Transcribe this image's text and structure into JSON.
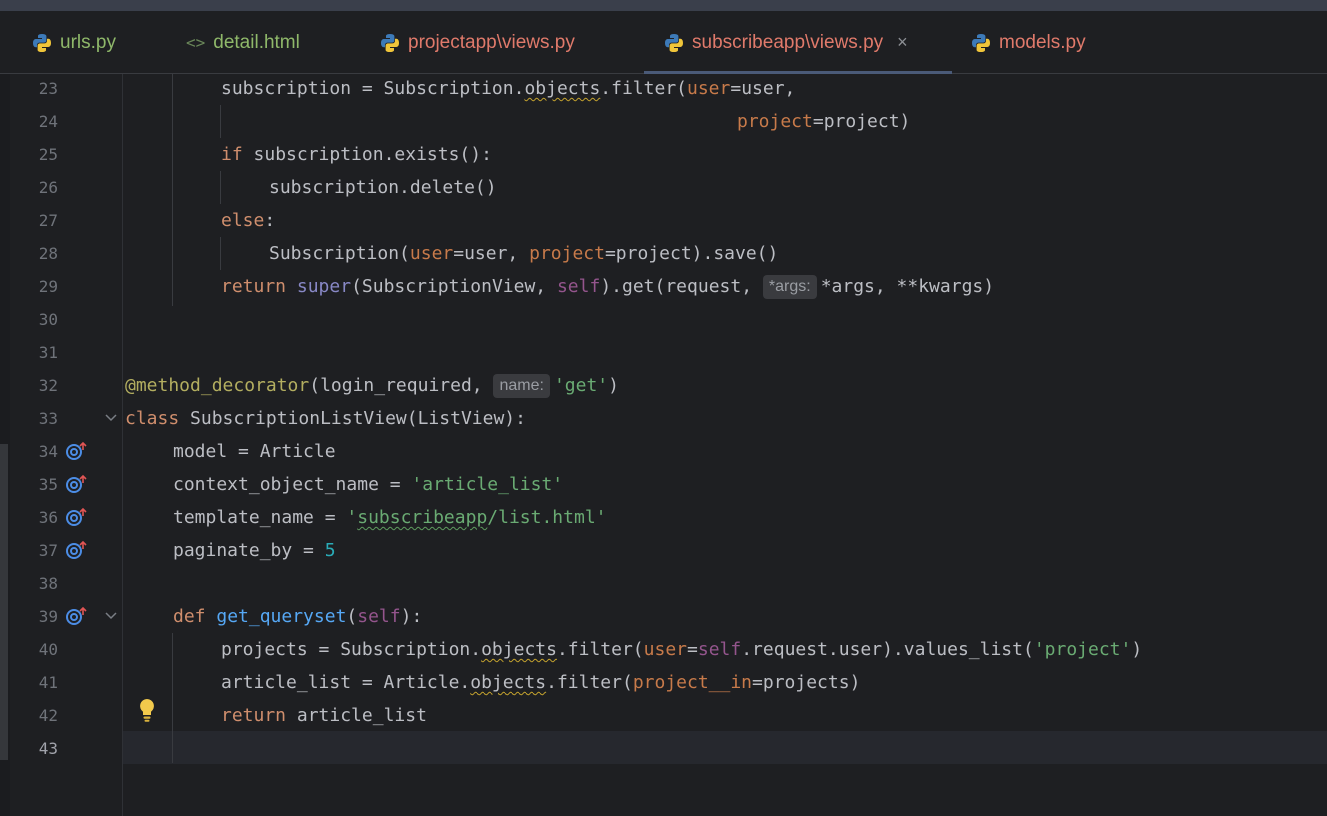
{
  "tabs": [
    {
      "label": "urls.py",
      "type": "python",
      "color": "#8fb86a"
    },
    {
      "label": "detail.html",
      "type": "html",
      "color": "#8fb86a"
    },
    {
      "label": "projectapp\\views.py",
      "type": "python",
      "color": "#e07a6b"
    },
    {
      "label": "subscribeapp\\views.py",
      "type": "python",
      "color": "#e07a6b",
      "active": true,
      "close": "×"
    },
    {
      "label": "models.py",
      "type": "python",
      "color": "#e07a6b"
    }
  ],
  "line_numbers": [
    "23",
    "24",
    "25",
    "26",
    "27",
    "28",
    "29",
    "30",
    "31",
    "32",
    "33",
    "34",
    "35",
    "36",
    "37",
    "38",
    "39",
    "40",
    "41",
    "42",
    "43"
  ],
  "code": {
    "l23": {
      "a": "subscription = Subscription.",
      "b": "objects",
      "c": ".filter(",
      "d": "user",
      "e": "=user,"
    },
    "l24": {
      "a": "project",
      "b": "=project)"
    },
    "l25": {
      "a": "if",
      "b": " subscription.exists():"
    },
    "l26": {
      "a": "subscription.delete()"
    },
    "l27": {
      "a": "else",
      "b": ":"
    },
    "l28": {
      "a": "Subscription(",
      "b": "user",
      "c": "=user, ",
      "d": "project",
      "e": "=project).save()"
    },
    "l29": {
      "a": "return",
      "b": " ",
      "c": "super",
      "d": "(SubscriptionView, ",
      "e": "self",
      "f": ").get(request, ",
      "hint": "*args:",
      "g": "*args, **kwargs)"
    },
    "l32": {
      "a": "@method_decorator",
      "b": "(login_required, ",
      "hint": "name:",
      "c": "'get'",
      "d": ")"
    },
    "l33": {
      "a": "class",
      "b": " SubscriptionListView(ListView):"
    },
    "l34": {
      "a": "model = Article"
    },
    "l35": {
      "a": "context_object_name = ",
      "b": "'article_list'"
    },
    "l36": {
      "a": "template_name = ",
      "b": "'",
      "c": "subscribeapp",
      "d": "/list.html'"
    },
    "l37": {
      "a": "paginate_by = ",
      "b": "5"
    },
    "l39": {
      "a": "def",
      "b": " ",
      "c": "get_queryset",
      "d": "(",
      "e": "self",
      "f": "):"
    },
    "l40": {
      "a": "projects = Subscription.",
      "b": "objects",
      "c": ".filter(",
      "d": "user",
      "e": "=",
      "f": "self",
      "g": ".request.user).values_list(",
      "h": "'project'",
      "i": ")"
    },
    "l41": {
      "a": "article_list = Article.",
      "b": "objects",
      "c": ".filter(",
      "d": "project__in",
      "e": "=projects)"
    },
    "l42": {
      "a": "return",
      "b": " article_list"
    }
  },
  "icons": {
    "python": "python-icon",
    "override": "override-method-icon",
    "bulb": "lightbulb-icon",
    "fold": "fold-chevron-icon"
  }
}
